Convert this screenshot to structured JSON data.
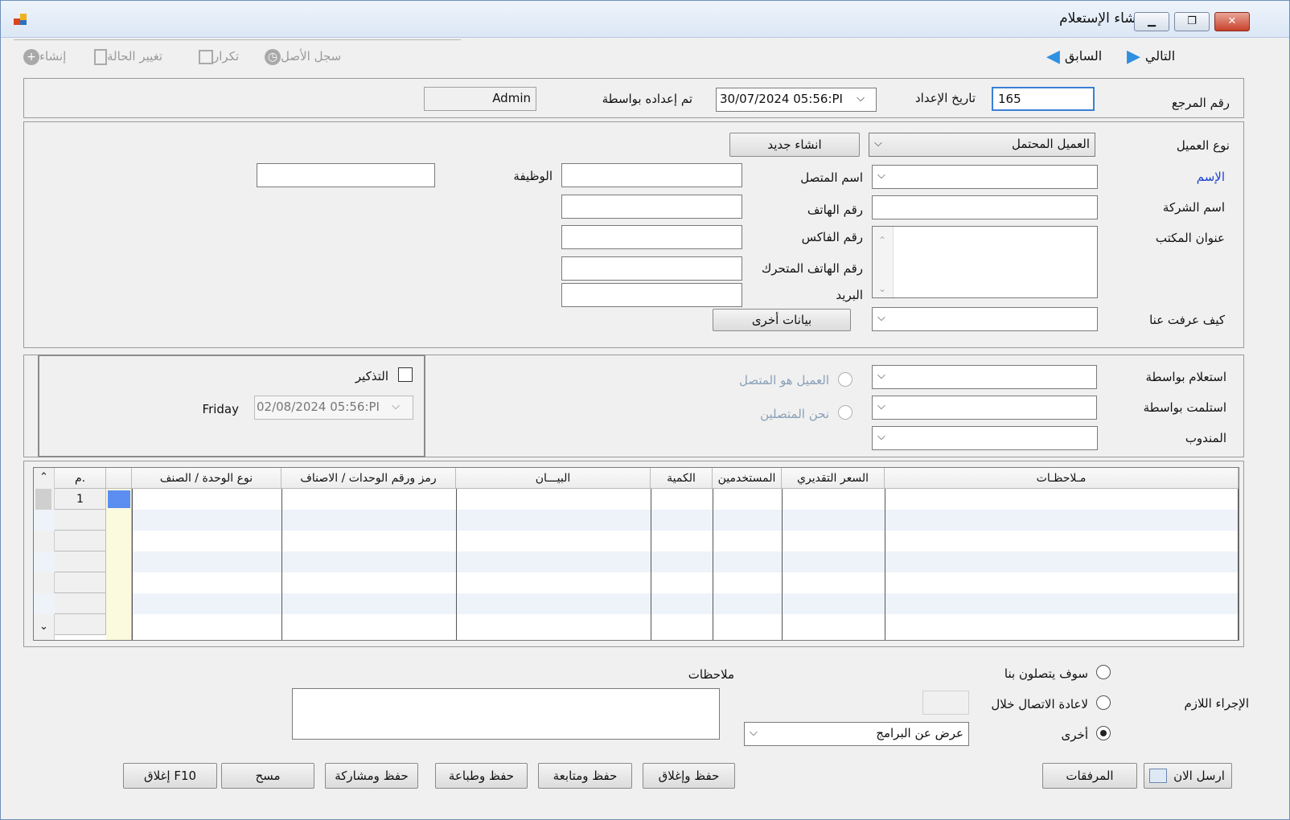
{
  "window": {
    "title": "إنشاء الإستعلام"
  },
  "toolbar": {
    "create_label": "إنشاء",
    "change_status_label": "تغيير الحالة",
    "repeat_label": "تكرار",
    "source_log_label": "سجل الأصل",
    "next_label": "التالي",
    "previous_label": "السابق"
  },
  "header": {
    "ref_label": "رقم المرجع",
    "ref_value": "165",
    "date_label": "تاريخ الإعداد",
    "date_value": "30/07/2024 05:56:PI",
    "prepared_by_label": "تم إعداده بواسطة",
    "prepared_by_value": "Admin"
  },
  "customer": {
    "type_label": "نوع العميل",
    "type_value": "العميل المحتمل",
    "new_button": "انشاء جديد",
    "name_label": "الإسم",
    "company_label": "اسم الشركة",
    "office_address_label": "عنوان المكتب",
    "how_known_label": "كيف عرفت عنا",
    "contact_name_label": "اسم المتصل",
    "phone_label": "رقم الهاتف",
    "fax_label": "رقم الفاكس",
    "mobile_label": "رقم الهاتف المتحرك",
    "email_label": "البريد",
    "job_label": "الوظيفة",
    "other_data_button": "بيانات أخرى"
  },
  "inquiry": {
    "inquiry_by_label": "استعلام بواسطة",
    "received_by_label": "استلمت بواسطة",
    "rep_label": "المندوب",
    "radio_customer_caller": "العميل هو المتصل",
    "radio_we_called": "نحن المتصلين",
    "reminder_label": "التذكير",
    "reminder_date": "02/08/2024 05:56:PI",
    "reminder_day": "Friday"
  },
  "grid": {
    "columns": [
      "م.",
      "نوع الوحدة / الصنف",
      "رمز ورقم الوحدات / الاصناف",
      "البيـــان",
      "الكمية",
      "المستخدمين",
      "السعر التقديري",
      "مـلاحظـات"
    ],
    "rows": [
      {
        "num": "1"
      }
    ]
  },
  "footer": {
    "notes_label": "ملاحظات",
    "required_action_label": "الإجراء اللازم",
    "radio_will_contact": "سوف يتصلون بنا",
    "radio_recall_within": "لاعادة الاتصال خلال",
    "radio_other": "أخرى",
    "other_value": "عرض عن البرامج",
    "send_now": "ارسل الان",
    "attachments": "المرفقات",
    "save_close": "حفظ وإغلاق",
    "save_follow": "حفظ ومتابعة",
    "save_print": "حفظ وطباعة",
    "save_share": "حفظ ومشاركة",
    "clear": "مسح",
    "close_f10": "إغلاق F10"
  }
}
